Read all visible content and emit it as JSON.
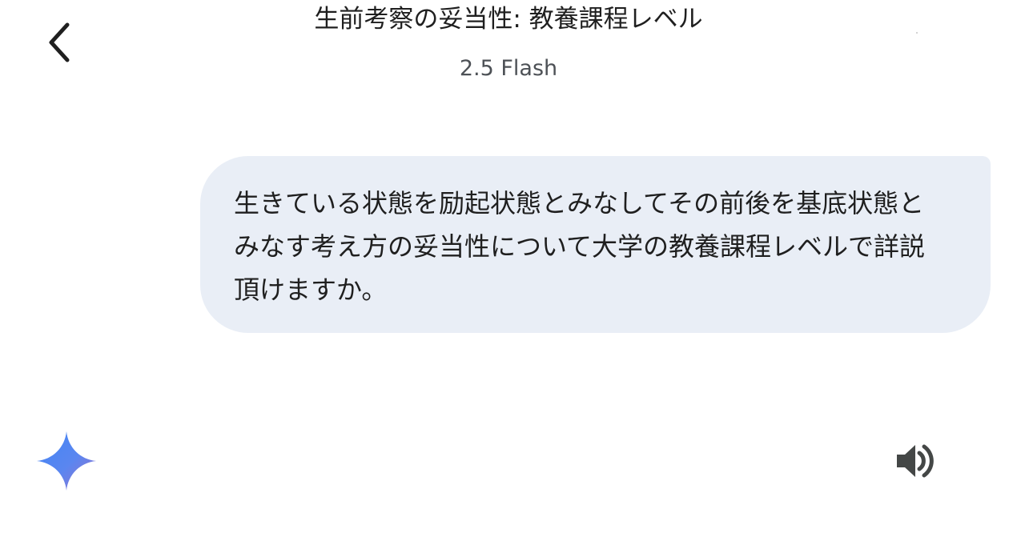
{
  "header": {
    "title": "生前考察の妥当性: 教養課程レベル",
    "model_label": "2.5 Flash"
  },
  "conversation": {
    "user_message": "生きている状態を励起状態とみなしてその前後を基底状態とみなす考え方の妥当性について大学の教養課程レベルで詳説頂けますか。"
  },
  "icons": {
    "back": "chevron-left-icon",
    "assistant": "gemini-spark-icon",
    "read_aloud": "speaker-icon"
  },
  "colors": {
    "bubble_background": "#e9eef6",
    "text_primary": "#1f1f1f",
    "text_secondary": "#4d5156",
    "spark_blue": "#4285f4",
    "spark_purple": "#9b72cb"
  }
}
